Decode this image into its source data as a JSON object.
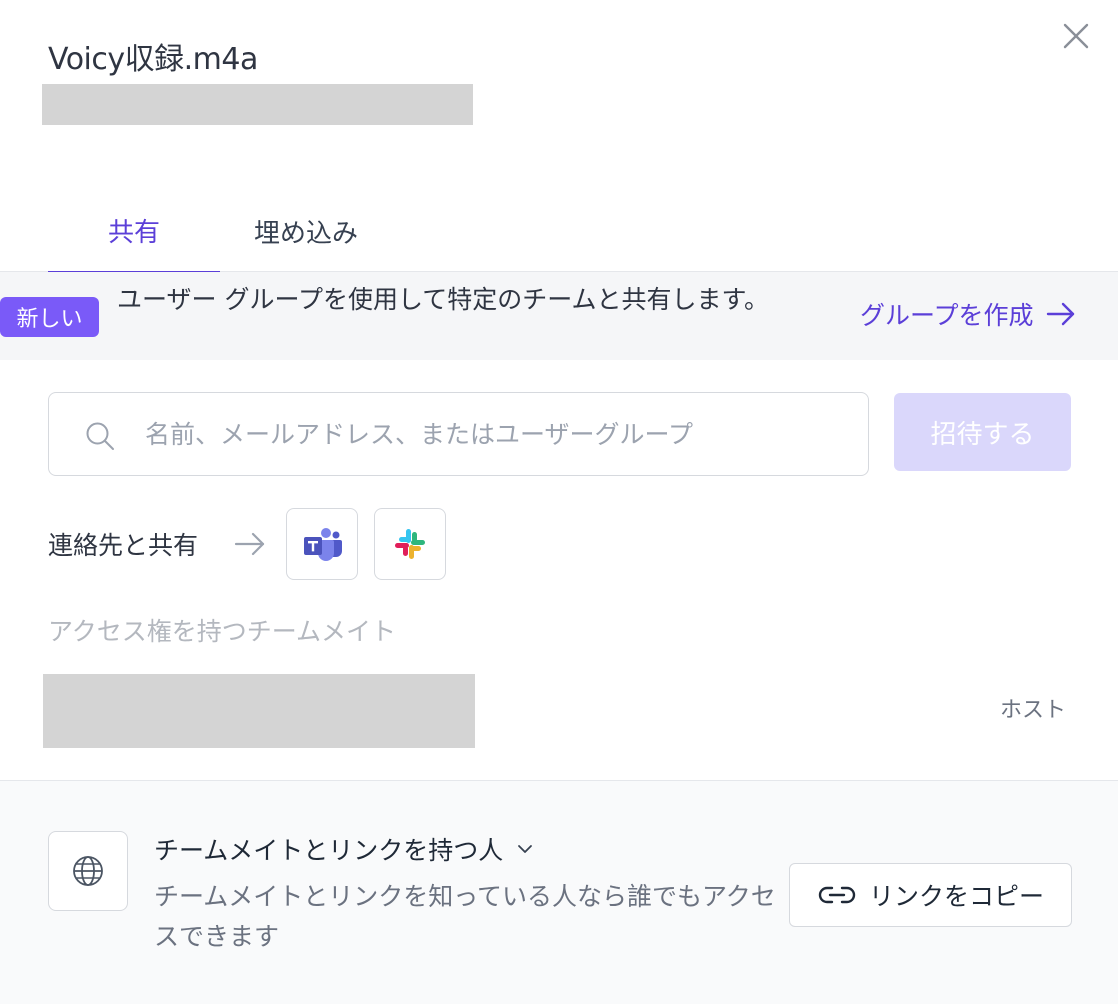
{
  "dialog": {
    "title": "Voicy収録.m4a"
  },
  "tabs": [
    {
      "label": "共有",
      "active": true
    },
    {
      "label": "埋め込み",
      "active": false
    }
  ],
  "banner": {
    "badge": "新しい",
    "text": "ユーザー グループを使用して特定のチームと共有します。",
    "link_label": "グループを作成"
  },
  "invite": {
    "placeholder": "名前、メールアドレス、またはユーザーグループ",
    "value": "",
    "button_label": "招待する"
  },
  "share_with_contacts": {
    "label": "連絡先と共有",
    "apps": [
      {
        "name": "teams-icon"
      },
      {
        "name": "slack-icon"
      }
    ]
  },
  "members": {
    "section_label": "アクセス権を持つチームメイト",
    "rows": [
      {
        "role": "ホスト"
      }
    ]
  },
  "link_access": {
    "selected": "チームメイトとリンクを持つ人",
    "description": "チームメイトとリンクを知っている人なら誰でもアクセスできます",
    "copy_button_label": "リンクをコピー"
  },
  "colors": {
    "accent": "#5b3fd8",
    "badge": "#7a5af8",
    "invite_disabled": "#dad7fb",
    "redacted": "#d4d4d4"
  }
}
